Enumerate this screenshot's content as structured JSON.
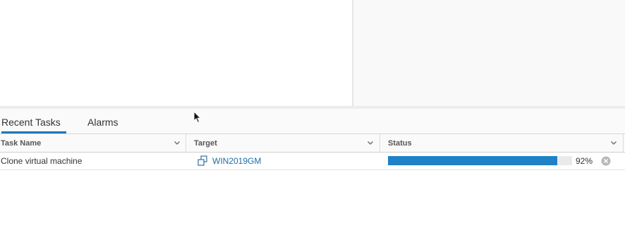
{
  "tabs": [
    {
      "label": "Recent Tasks",
      "active": true
    },
    {
      "label": "Alarms",
      "active": false
    }
  ],
  "columns": [
    "Task Name",
    "Target",
    "Status"
  ],
  "tasks": [
    {
      "task_name": "Clone virtual machine",
      "target": "WIN2019GM",
      "target_icon": "vm-template-icon",
      "progress_percent": 92,
      "status_text": "92%"
    }
  ],
  "colors": {
    "accent": "#1e76b9",
    "progress": "#1f82c6",
    "link": "#1a6fa8"
  }
}
